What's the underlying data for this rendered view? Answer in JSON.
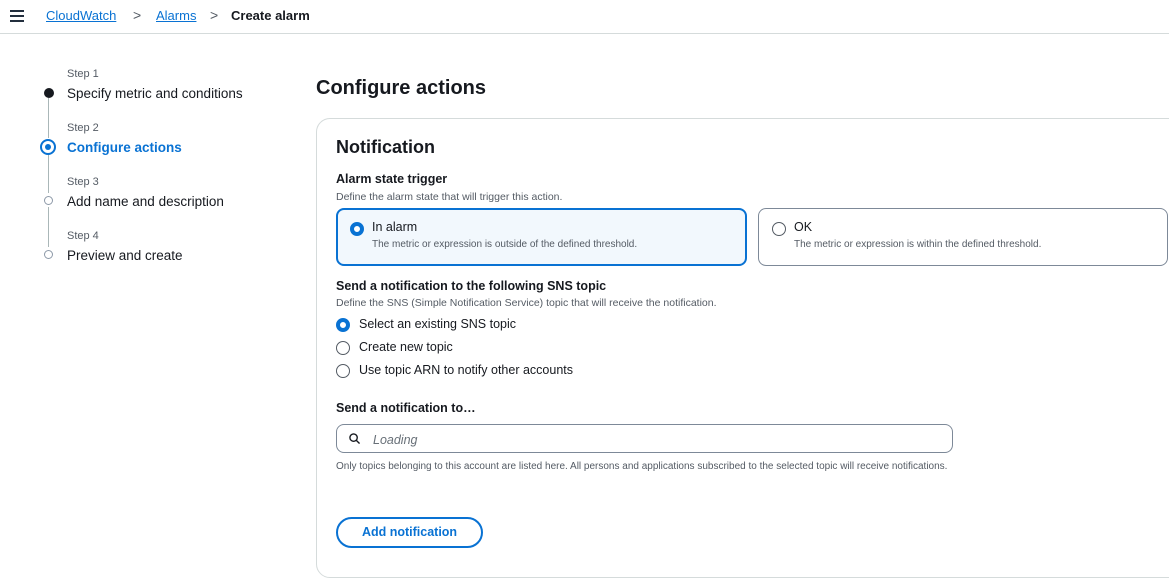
{
  "breadcrumb": {
    "items": [
      "CloudWatch",
      "Alarms",
      "Create alarm"
    ],
    "separator": ">"
  },
  "steps": [
    {
      "num": "Step 1",
      "title": "Specify metric and conditions",
      "state": "completed"
    },
    {
      "num": "Step 2",
      "title": "Configure actions",
      "state": "active"
    },
    {
      "num": "Step 3",
      "title": "Add name and description",
      "state": "pending"
    },
    {
      "num": "Step 4",
      "title": "Preview and create",
      "state": "pending"
    }
  ],
  "page_title": "Configure actions",
  "notification": {
    "title": "Notification",
    "trigger": {
      "label": "Alarm state trigger",
      "description": "Define the alarm state that will trigger this action.",
      "options": [
        {
          "title": "In alarm",
          "desc": "The metric or expression is outside of the defined threshold.",
          "selected": true
        },
        {
          "title": "OK",
          "desc": "The metric or expression is within the defined threshold.",
          "selected": false
        }
      ]
    },
    "sns": {
      "label": "Send a notification to the following SNS topic",
      "description": "Define the SNS (Simple Notification Service) topic that will receive the notification.",
      "options": [
        {
          "label": "Select an existing SNS topic",
          "selected": true
        },
        {
          "label": "Create new topic",
          "selected": false
        },
        {
          "label": "Use topic ARN to notify other accounts",
          "selected": false
        }
      ]
    },
    "send_to": {
      "label": "Send a notification to…",
      "placeholder": "Loading",
      "help": "Only topics belonging to this account are listed here. All persons and applications subscribed to the selected topic will receive notifications."
    },
    "add_button": "Add notification"
  },
  "colors": {
    "accent": "#0972d3",
    "selected_tile_bg": "#f2f8fd",
    "text": "#16191f",
    "muted": "#545b64"
  },
  "icons": {
    "menu": "hamburger-menu-icon",
    "search": "search-icon",
    "chevron": "chevron-right-icon"
  }
}
